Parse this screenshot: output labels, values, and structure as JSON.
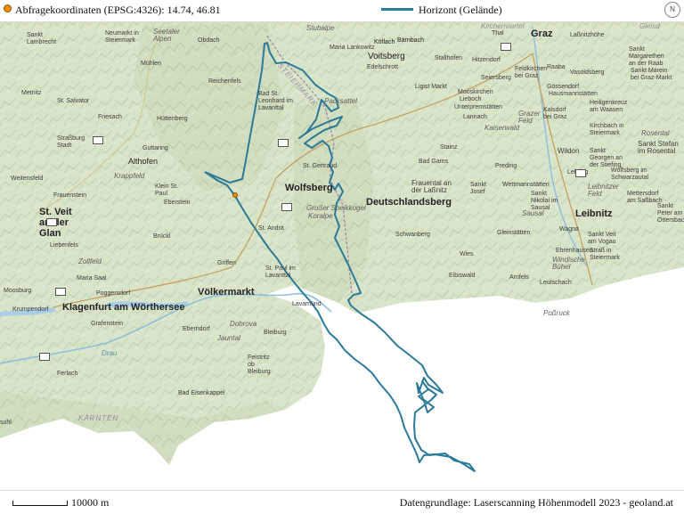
{
  "header": {
    "coord_label": "Abfragekoordinaten (EPSG:4326): 14.74, 46.81",
    "legend_label": "Horizont (Gelände)",
    "compass_label": "N"
  },
  "footer": {
    "scale_label": "10000 m",
    "source_label": "Datengrundlage: Laserscanning Höhenmodell 2023 - geoland.at"
  },
  "colors": {
    "horizon_line": "#2a7a99",
    "query_point": "#f08c00",
    "terrain": "#d6e3c6",
    "lowland": "#ffffff"
  },
  "places": {
    "graz": "Graz",
    "wolfsberg": "Wolfsberg",
    "deutschlandsberg": "Deutschlandsberg",
    "voelkermarkt": "Völkermarkt",
    "klagenfurt": "Klagenfurt am Wörthersee",
    "st_veit": "St. Veit an der Glan",
    "voitsberg": "Voitsberg",
    "leibnitz": "Leibnitz",
    "koeflach": "Köflach",
    "bärnbach": "Bärnbach",
    "thal": "Thal",
    "lassnitzhoehe": "Laßnitzhöhe",
    "obdach": "Obdach",
    "neumarkt": "Neumarkt in Steiermark",
    "lambrecht": "Sankt Lambrecht",
    "muehlen": "Mühlen",
    "reichenfels": "Reichenfels",
    "st_leonhard": "Bad St. Leonhard im Lavanttal",
    "metnitz": "Metnitz",
    "st_salvator": "St. Salvator",
    "friesach": "Friesach",
    "huettenberg": "Hüttenberg",
    "strassburg": "Straßburg Stadt",
    "guttaring": "Guttaring",
    "althofen": "Althofen",
    "weitensfeld": "Weitensfeld",
    "klein_st_paul": "Klein St. Paul",
    "frauenstein": "Frauenstein",
    "eberstein": "Eberstein",
    "brueckl": "Brückl",
    "liebenfels": "Liebenfels",
    "maria_saal": "Maria Saal",
    "poggersdorf": "Poggersdorf",
    "moosburg": "Moosburg",
    "krumpendorf": "Krumpendorf",
    "grafenstein": "Grafenstein",
    "griffen": "Griffen",
    "st_andrae": "St. Andrä",
    "st_paul": "St. Paul im Lavanttal",
    "st_gertraud": "St. Gertraud",
    "lavamuend": "Lavamünd",
    "eberndorf": "Eberndorf",
    "bleiburg": "Bleiburg",
    "feistritz": "Feistritz ob Bleiburg",
    "ferlach": "Ferlach",
    "bad_eisenkappel": "Bad Eisenkappel",
    "edelschrott": "Edelschrott",
    "ligist": "Ligist Markt",
    "moosk": "Mooskirchen",
    "lieboch": "Lieboch",
    "unterpremstaetten": "Unterpremstätten",
    "lannach": "Lannach",
    "stainz": "Stainz",
    "bad_gams": "Bad Gams",
    "preding": "Preding",
    "frauental": "Frauental an der Laßnitz",
    "st_josef": "Sankt Josef",
    "wettmannstaetten": "Wettmannstätten",
    "schwanberg": "Schwanberg",
    "eibiswald": "Eibiswald",
    "wies": "Wies",
    "gleinstaetten": "Gleinstätten",
    "arnfels": "Arnfels",
    "leutschach": "Leutschach",
    "wagna": "Wagna",
    "ehrenhausen": "Ehrenhausen",
    "strass": "Straß in Steiermark",
    "wildon": "Wildon",
    "kalsdorf": "Kalsdorf bei Graz",
    "gössendorf": "Gössendorf",
    "hausmannstaetten": "Hausmannstätten",
    "raaba": "Raaba",
    "vasoldsberg": "Vasoldsberg",
    "feldkirchen": "Feldkirchen bei Graz",
    "seiersberg": "Seiersberg",
    "hitzendorf": "Hitzendorf",
    "stallhofen": "Stallhofen",
    "maria_lankowitz": "Maria Lankowitz",
    "st_margarethen": "Sankt Margarethen an der Raab",
    "st_marein": "Sankt Marein bei Graz-Markt",
    "heiligenkreuz": "Heiligenkreuz am Waasen",
    "kirchbach": "Kirchbach in Steiermark",
    "st_stefan": "Sankt Stefan im Rosental",
    "st_georgen": "Sankt Georgen an der Stiefing",
    "lebring": "Lebring",
    "wolfsberg_schwarzautal": "Wolfsberg im Schwarzautal",
    "mettersdorf": "Mettersdorf am Saßbach",
    "st_peter": "Sankt Peter am Ottersbach",
    "st_nikolai": "Sankt Nikolai im Sausal",
    "st_veit_vogau": "Sankt Veit am Vogau",
    "region_seetaler_alpen": "Seetaler Alpen",
    "region_stubalpe": "Stubalpe",
    "region_packsattel": "Packsattel",
    "region_krappfeld": "Krappfeld",
    "region_zollfeld": "Zollfeld",
    "region_koralpe": "Koralpe",
    "region_grosser_speikkogel": "Großer Speikkogel",
    "region_dobrova": "Dobrova",
    "region_jauntal": "Jauntal",
    "region_drau": "Drau",
    "region_karnten": "KÄRNTEN",
    "region_kaiserwald": "Kaiserwald",
    "region_grazer_feld": "Grazer Feld",
    "region_sausal": "Sausal",
    "region_leibnitzer_feld": "Leibnitzer Feld",
    "region_windische_buehel": "Windische Bühel",
    "region_possruck": "Poßruck",
    "region_rosental": "Rosental",
    "region_kirchenviertel": "Kirchenviertel",
    "region_gleisdorf": "Gleisd",
    "region_stmark": "STEIERMARK",
    "region_suhl": "suhl"
  }
}
